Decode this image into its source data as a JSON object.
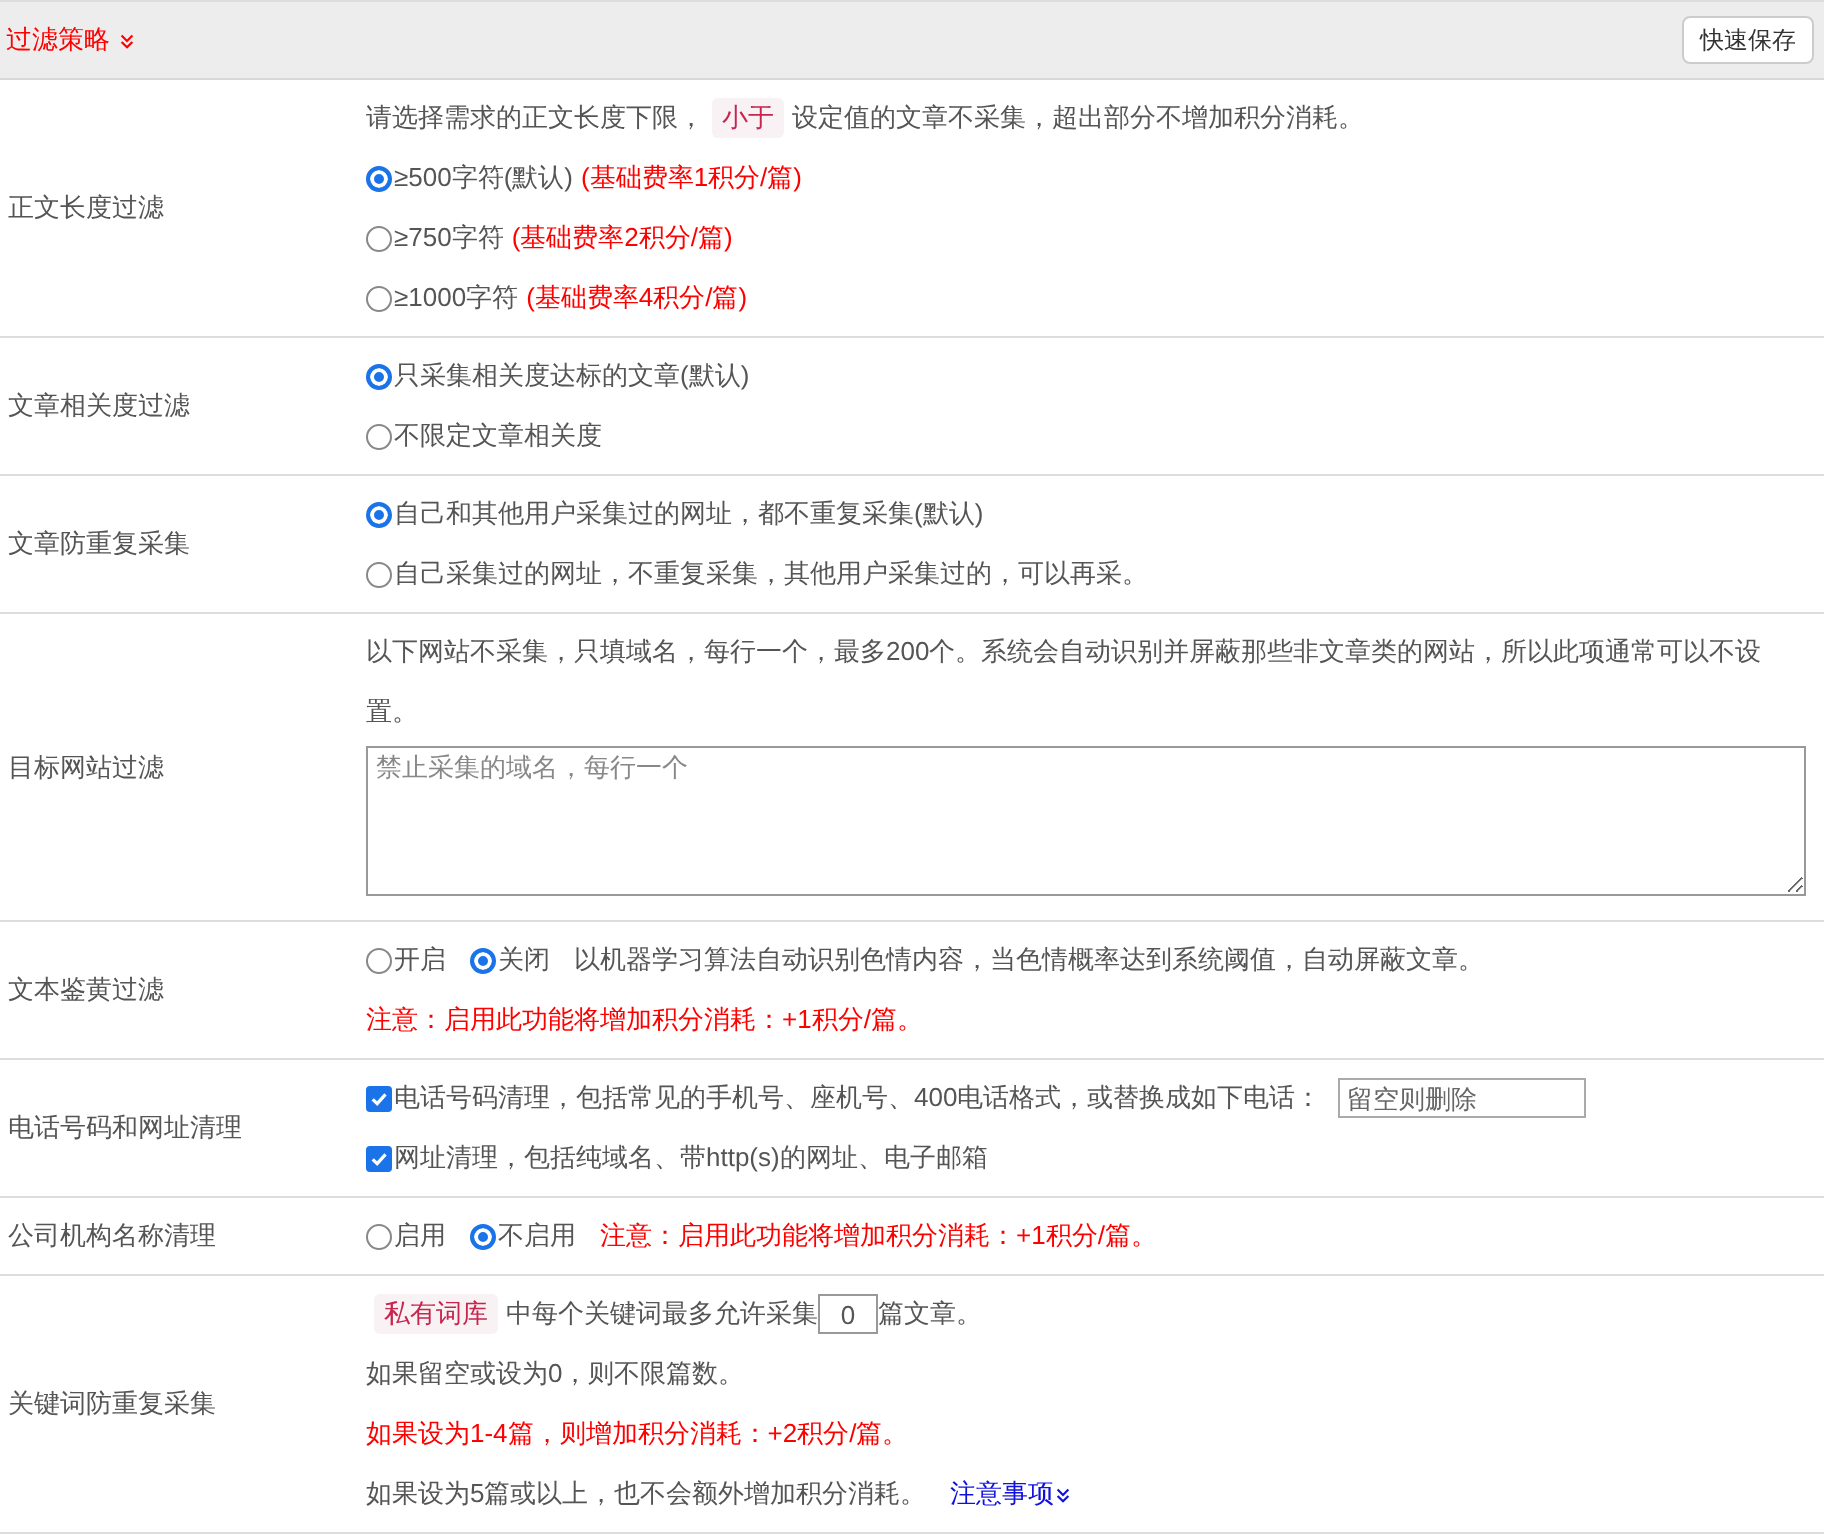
{
  "header": {
    "title": "过滤策略",
    "save_button": "快速保存"
  },
  "rows": [
    {
      "label": "正文长度过滤",
      "lines": [
        {
          "kind": "tagged",
          "before": "请选择需求的正文长度下限，",
          "tag": "小于",
          "after": "设定值的文章不采集，超出部分不增加积分消耗。"
        },
        {
          "kind": "radio",
          "label": "≥500字符(默认)",
          "note": "(基础费率1积分/篇)",
          "selected": true
        },
        {
          "kind": "radio",
          "label": "≥750字符",
          "note": "(基础费率2积分/篇)",
          "selected": false
        },
        {
          "kind": "radio",
          "label": "≥1000字符",
          "note": "(基础费率4积分/篇)",
          "selected": false
        }
      ]
    },
    {
      "label": "文章相关度过滤",
      "lines": [
        {
          "kind": "radio",
          "label": "只采集相关度达标的文章(默认)",
          "selected": true
        },
        {
          "kind": "radio",
          "label": "不限定文章相关度",
          "selected": false
        }
      ]
    },
    {
      "label": "文章防重复采集",
      "lines": [
        {
          "kind": "radio",
          "label": "自己和其他用户采集过的网址，都不重复采集(默认)",
          "selected": true
        },
        {
          "kind": "radio",
          "label": "自己采集过的网址，不重复采集，其他用户采集过的，可以再采。",
          "selected": false
        }
      ]
    },
    {
      "label": "目标网站过滤",
      "lines": [
        {
          "kind": "text",
          "text": "以下网站不采集，只填域名，每行一个，最多200个。系统会自动识别并屏蔽那些非文章类的网站，所以此项通常可以不设置。"
        },
        {
          "kind": "textarea",
          "placeholder": "禁止采集的域名，每行一个"
        }
      ]
    },
    {
      "label": "文本鉴黄过滤",
      "lines": [
        {
          "kind": "radio_row",
          "options": [
            {
              "label": "开启",
              "selected": false
            },
            {
              "label": "关闭",
              "selected": true
            }
          ],
          "note": {
            "kind": "plain",
            "text": "以机器学习算法自动识别色情内容，当色情概率达到系统阈值，自动屏蔽文章。"
          }
        },
        {
          "kind": "warning",
          "text": "注意：启用此功能将增加积分消耗：+1积分/篇。"
        }
      ]
    },
    {
      "label": "电话号码和网址清理",
      "lines": [
        {
          "kind": "checkbox",
          "label": "电话号码清理，包括常见的手机号、座机号、400电话格式，或替换成如下电话：",
          "checked": true,
          "input": {
            "placeholder": "留空则删除"
          }
        },
        {
          "kind": "checkbox",
          "label": "网址清理，包括纯域名、带http(s)的网址、电子邮箱",
          "checked": true
        }
      ]
    },
    {
      "label": "公司机构名称清理",
      "lines": [
        {
          "kind": "radio_row",
          "options": [
            {
              "label": "启用",
              "selected": false
            },
            {
              "label": "不启用",
              "selected": true
            }
          ],
          "note": {
            "kind": "warning",
            "text": "注意：启用此功能将增加积分消耗：+1积分/篇。"
          }
        }
      ]
    },
    {
      "label": "关键词防重复采集",
      "lines": [
        {
          "kind": "tagged_input",
          "tag": "私有词库",
          "before": "中每个关键词最多允许采集",
          "value": "0",
          "after": "篇文章。"
        },
        {
          "kind": "text",
          "text": "如果留空或设为0，则不限篇数。"
        },
        {
          "kind": "warning",
          "text": "如果设为1-4篇，则增加积分消耗：+2积分/篇。"
        },
        {
          "kind": "text_link",
          "text": "如果设为5篇或以上，也不会额外增加积分消耗。",
          "link": "注意事项"
        }
      ]
    }
  ]
}
